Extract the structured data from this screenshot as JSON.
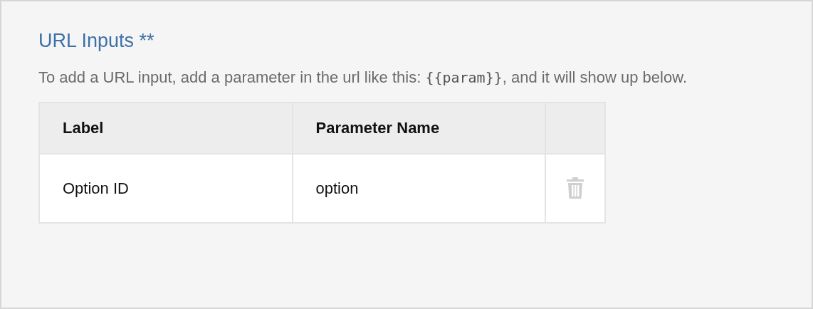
{
  "section": {
    "title": "URL Inputs **",
    "description": {
      "before": "To add a URL input, add a parameter in the url like this: ",
      "code": "{{param}}",
      "after": ", and it will show up below."
    }
  },
  "table": {
    "columns": [
      "Label",
      "Parameter Name"
    ],
    "rows": [
      {
        "label": "Option ID",
        "parameter": "option",
        "disabled": true
      }
    ]
  }
}
